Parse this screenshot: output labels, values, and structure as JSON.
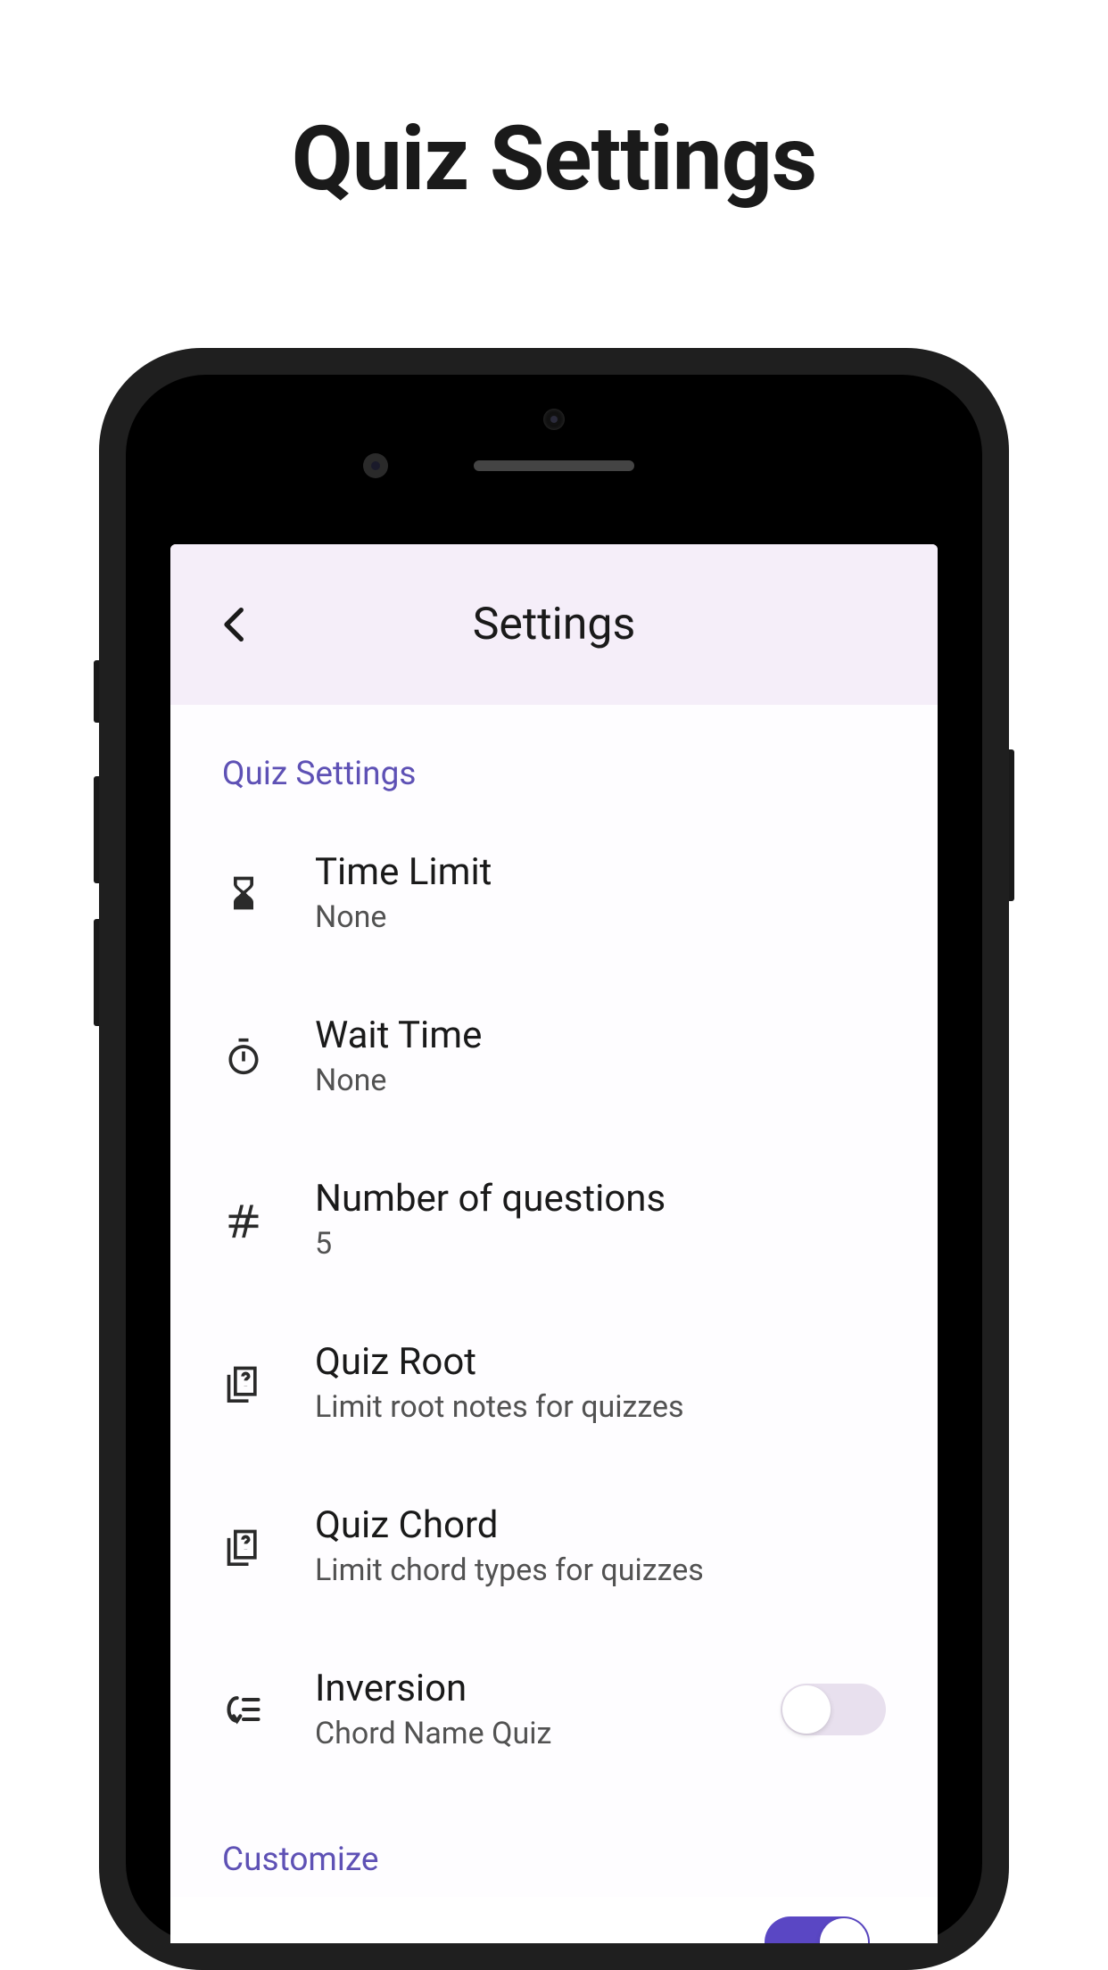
{
  "page_heading": "Quiz Settings",
  "app": {
    "header_title": "Settings"
  },
  "sections": {
    "quiz": {
      "header": "Quiz Settings",
      "items": [
        {
          "title": "Time Limit",
          "subtitle": "None"
        },
        {
          "title": "Wait Time",
          "subtitle": "None"
        },
        {
          "title": "Number of questions",
          "subtitle": "5"
        },
        {
          "title": "Quiz Root",
          "subtitle": "Limit root notes for quizzes"
        },
        {
          "title": "Quiz Chord",
          "subtitle": "Limit chord types for quizzes"
        },
        {
          "title": "Inversion",
          "subtitle": "Chord Name Quiz",
          "toggle": false
        }
      ]
    },
    "customize": {
      "header": "Customize"
    }
  },
  "colors": {
    "accent": "#5e51b5",
    "header_bg": "#f5eef9"
  }
}
